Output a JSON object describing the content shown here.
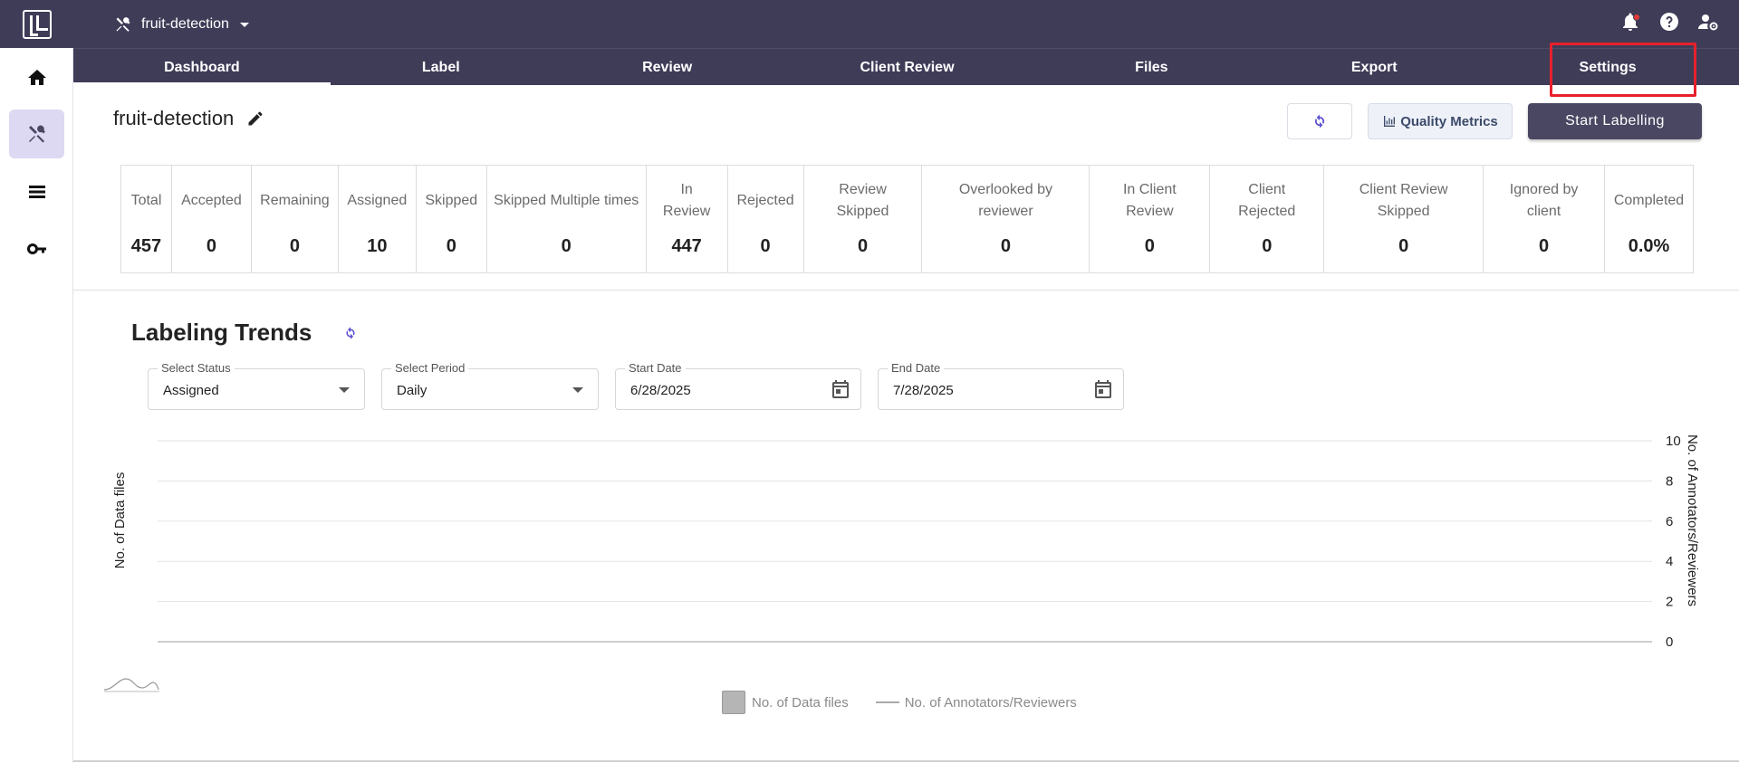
{
  "app": {
    "project_name": "fruit-detection"
  },
  "tabs": [
    {
      "label": "Dashboard"
    },
    {
      "label": "Label"
    },
    {
      "label": "Review"
    },
    {
      "label": "Client Review"
    },
    {
      "label": "Files"
    },
    {
      "label": "Export"
    },
    {
      "label": "Settings"
    }
  ],
  "header": {
    "title": "fruit-detection",
    "quality_metrics_label": "Quality Metrics",
    "start_labelling_label": "Start Labelling"
  },
  "stats": [
    {
      "label": "Total",
      "value": "457"
    },
    {
      "label": "Accepted",
      "value": "0"
    },
    {
      "label": "Remaining",
      "value": "0"
    },
    {
      "label": "Assigned",
      "value": "10"
    },
    {
      "label": "Skipped",
      "value": "0"
    },
    {
      "label": "Skipped Multiple times",
      "value": "0"
    },
    {
      "label": "In Review",
      "value": "447"
    },
    {
      "label": "Rejected",
      "value": "0"
    },
    {
      "label": "Review Skipped",
      "value": "0"
    },
    {
      "label": "Overlooked by reviewer",
      "value": "0"
    },
    {
      "label": "In Client Review",
      "value": "0"
    },
    {
      "label": "Client Rejected",
      "value": "0"
    },
    {
      "label": "Client Review Skipped",
      "value": "0"
    },
    {
      "label": "Ignored by client",
      "value": "0"
    },
    {
      "label": "Completed",
      "value": "0.0%"
    }
  ],
  "trends": {
    "title": "Labeling Trends",
    "status": {
      "label": "Select Status",
      "value": "Assigned"
    },
    "period": {
      "label": "Select Period",
      "value": "Daily"
    },
    "start_date": {
      "label": "Start Date",
      "value": "6/28/2025"
    },
    "end_date": {
      "label": "End Date",
      "value": "7/28/2025"
    }
  },
  "chart_data": {
    "type": "bar",
    "categories": [],
    "series": [
      {
        "name": "No. of Data files",
        "values": []
      },
      {
        "name": "No. of Annotators/Reviewers",
        "values": []
      }
    ],
    "ylabel_left": "No. of Data files",
    "ylabel_right": "No. of Annotators/Reviewers",
    "right_ticks": [
      "10",
      "8",
      "6",
      "4",
      "2",
      "0"
    ],
    "ylim_right": [
      0,
      10
    ],
    "grid": true,
    "legend_position": "bottom"
  },
  "colors": {
    "header_bg": "#3f3c58",
    "active_side": "#ddd9f3",
    "highlight": "#e8202b",
    "accent": "#5b4fd0"
  },
  "icons": {
    "sidebar": [
      "home-icon",
      "tools-icon",
      "list-icon",
      "key-icon"
    ],
    "top": [
      "notification-icon",
      "help-icon",
      "user-settings-icon"
    ]
  }
}
